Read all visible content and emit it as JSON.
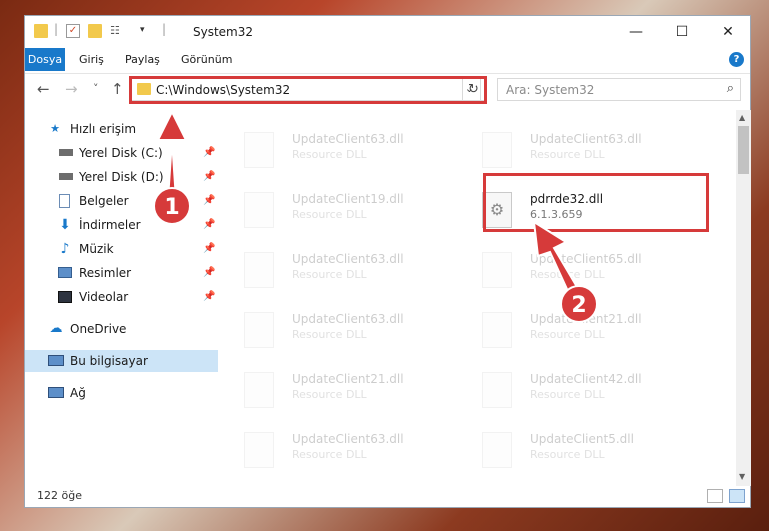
{
  "window": {
    "title": "System32",
    "controls": {
      "minimize": "—",
      "maximize": "☐",
      "close": "✕"
    }
  },
  "ribbon": {
    "tabs": [
      "Dosya",
      "Giriş",
      "Paylaş",
      "Görünüm"
    ],
    "help": "?"
  },
  "nav": {
    "back": "←",
    "forward": "→",
    "recent": "˅",
    "up": "↑",
    "address": "C:\\Windows\\System32",
    "address_chevron": "⌄",
    "refresh": "↻",
    "search_placeholder": "Ara: System32",
    "search_icon": "⌕"
  },
  "sidebar": {
    "items": [
      {
        "label": "Hızlı erişim",
        "icon": "star-icon",
        "pin": false
      },
      {
        "label": "Yerel Disk (C:)",
        "icon": "drive-icon",
        "pin": true
      },
      {
        "label": "Yerel Disk (D:)",
        "icon": "drive-icon",
        "pin": true
      },
      {
        "label": "Belgeler",
        "icon": "documents-icon",
        "pin": true
      },
      {
        "label": "İndirmeler",
        "icon": "download-icon",
        "pin": true
      },
      {
        "label": "Müzik",
        "icon": "music-icon",
        "pin": true
      },
      {
        "label": "Resimler",
        "icon": "pictures-icon",
        "pin": true
      },
      {
        "label": "Videolar",
        "icon": "video-icon",
        "pin": true
      },
      {
        "label": "OneDrive",
        "icon": "cloud-icon",
        "pin": false
      },
      {
        "label": "Bu bilgisayar",
        "icon": "computer-icon",
        "pin": false
      },
      {
        "label": "Ağ",
        "icon": "network-icon",
        "pin": false
      }
    ],
    "pin_glyph": "📌"
  },
  "files": [
    {
      "name": "UpdateClient63.dll",
      "desc": "Resource DLL",
      "highlight": false
    },
    {
      "name": "UpdateClient63.dll",
      "desc": "Resource DLL",
      "highlight": false
    },
    {
      "name": "UpdateClient19.dll",
      "desc": "Resource DLL",
      "highlight": false
    },
    {
      "name": "pdrrde32.dll",
      "desc": "6.1.3.659",
      "highlight": true
    },
    {
      "name": "UpdateClient63.dll",
      "desc": "Resource DLL",
      "highlight": false
    },
    {
      "name": "UpdateClient65.dll",
      "desc": "Resource DLL",
      "highlight": false
    },
    {
      "name": "UpdateClient63.dll",
      "desc": "Resource DLL",
      "highlight": false
    },
    {
      "name": "UpdateClient21.dll",
      "desc": "Resource DLL",
      "highlight": false
    },
    {
      "name": "UpdateClient21.dll",
      "desc": "Resource DLL",
      "highlight": false
    },
    {
      "name": "UpdateClient42.dll",
      "desc": "Resource DLL",
      "highlight": false
    },
    {
      "name": "UpdateClient63.dll",
      "desc": "Resource DLL",
      "highlight": false
    },
    {
      "name": "UpdateClient5.dll",
      "desc": "Resource DLL",
      "highlight": false
    }
  ],
  "status": {
    "count": "122 öğe"
  },
  "annotations": {
    "step1": "1",
    "step2": "2",
    "color": "#d63a3a"
  },
  "colors": {
    "accent": "#1979ca",
    "folder": "#f2c94c",
    "selected": "#cce4f7"
  }
}
